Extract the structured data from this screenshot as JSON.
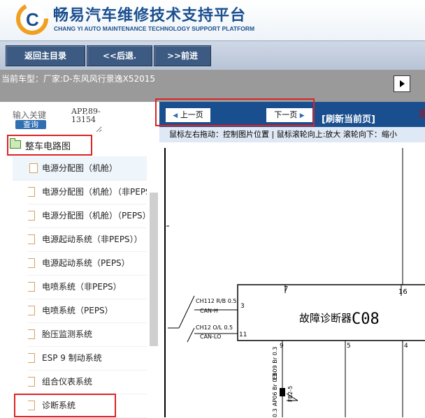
{
  "header": {
    "title_cn": "畅易汽车维修技术支持平台",
    "title_en": "CHANG YI AUTO MAINTENANCE TECHNOLOGY SUPPORT PLATFORM"
  },
  "nav": {
    "home": "返回主目录",
    "back": "<<后退.",
    "forward": ">>前进"
  },
  "car": {
    "label": "当前车型：",
    "value": "厂家:D-东风风行景逸X52015"
  },
  "search": {
    "label": "输入关键",
    "value": "APP,89-13154",
    "button": "查询"
  },
  "tree": {
    "root": "整车电路图",
    "items": [
      "电源分配图（机舱）",
      "电源分配图（机舱）（非PEPS）",
      "电源分配图（机舱）（PEPS）",
      "电源起动系统（非PEPS））",
      "电源起动系统（PEPS）",
      "电喷系统（非PEPS）",
      "电喷系统（PEPS）",
      "胎压监测系统",
      "ESP 9 制动系统",
      "组合仪表系统",
      "诊断系统"
    ]
  },
  "viewer": {
    "prev": "上一页",
    "next": "下一页",
    "refresh": "[刷新当前页]",
    "hint": "鼠标左右拖动：控制图片位置 | 鼠标滚轮向上:放大  滚轮向下：缩小",
    "extra_mark": "当"
  },
  "diagram": {
    "module_name": "故障诊断器",
    "module_code": "C08",
    "pin_top_left": "7",
    "pin_top_right": "16",
    "pin_3": "3",
    "pin_11": "11",
    "pin_9": "9",
    "pin_5": "5",
    "pin_4": "4",
    "wire1": "CH112 R/B 0.5",
    "wire1_sig": "CAN-H",
    "wire2": "CH12 O/L 0.5",
    "wire2_sig": "CAN-LO",
    "wire3": "EB09 Br 0.3",
    "wire4": "AP06 Br 0.3",
    "splice": "FB2-5",
    "wire5": "0.3"
  }
}
